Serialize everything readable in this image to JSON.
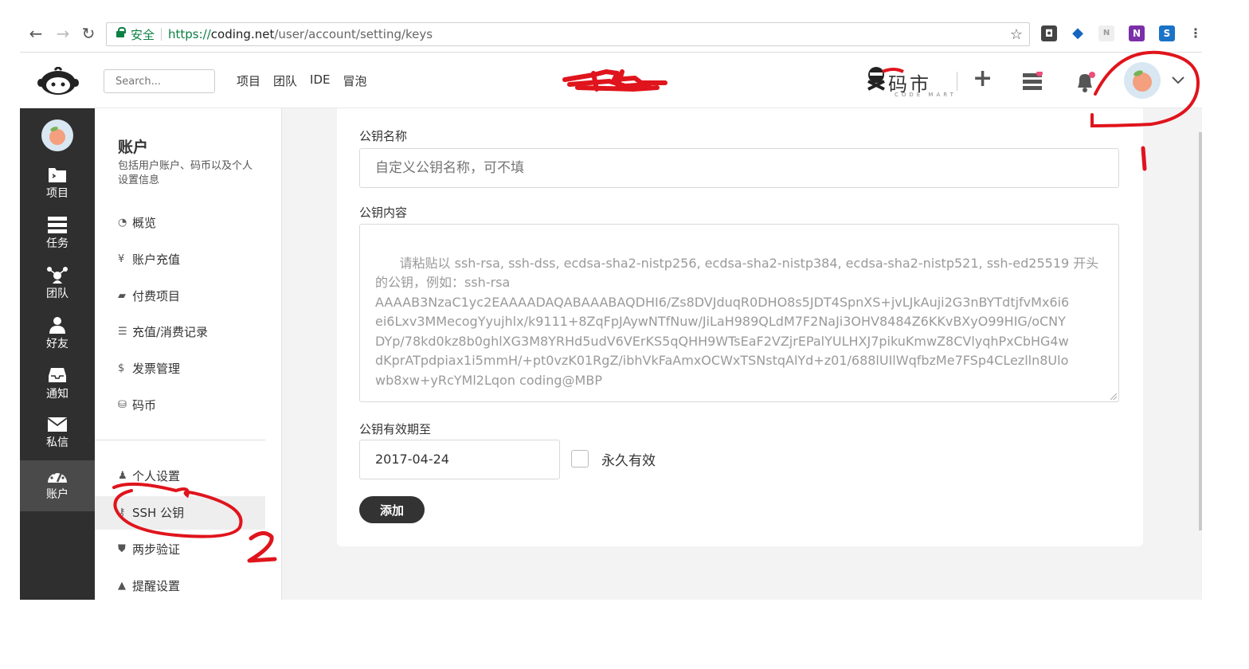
{
  "browser": {
    "secure_label": "安全",
    "url_scheme": "https://",
    "url_host": "coding.net",
    "url_path": "/user/account/setting/keys"
  },
  "header": {
    "search_placeholder": "Search...",
    "nav": [
      "项目",
      "团队",
      "IDE",
      "冒泡"
    ],
    "codemart_text": "码市",
    "codemart_sub": "CODE MART"
  },
  "dark_sidebar": {
    "items": [
      {
        "label": "项目",
        "icon": "project-folder-icon"
      },
      {
        "label": "任务",
        "icon": "tasks-icon"
      },
      {
        "label": "团队",
        "icon": "team-icon"
      },
      {
        "label": "好友",
        "icon": "friends-icon"
      },
      {
        "label": "通知",
        "icon": "notification-inbox-icon"
      },
      {
        "label": "私信",
        "icon": "message-envelope-icon"
      },
      {
        "label": "账户",
        "icon": "account-dashboard-icon"
      }
    ],
    "active": "账户"
  },
  "account_sidebar": {
    "title": "账户",
    "description": "包括用户账户、码币以及个人设置信息",
    "items": [
      {
        "label": "概览",
        "icon": "dashboard-icon"
      },
      {
        "label": "账户充值",
        "icon": "yen-icon"
      },
      {
        "label": "付费项目",
        "icon": "folder-icon"
      },
      {
        "label": "充值/消费记录",
        "icon": "list-icon"
      },
      {
        "label": "发票管理",
        "icon": "dollar-icon"
      },
      {
        "label": "码币",
        "icon": "coins-icon"
      },
      {
        "label": "个人设置",
        "icon": "user-icon"
      },
      {
        "label": "SSH 公钥",
        "icon": "key-icon"
      },
      {
        "label": "两步验证",
        "icon": "shield-icon"
      },
      {
        "label": "提醒设置",
        "icon": "bell-icon"
      }
    ],
    "active": "SSH 公钥"
  },
  "form": {
    "name_label": "公钥名称",
    "name_placeholder": "自定义公钥名称，可不填",
    "content_label": "公钥内容",
    "content_placeholder": "请粘贴以 ssh-rsa, ssh-dss, ecdsa-sha2-nistp256, ecdsa-sha2-nistp384, ecdsa-sha2-nistp521, ssh-ed25519 开头\n的公钥，例如：ssh-rsa\nAAAAB3NzaC1yc2EAAAADAQABAAABAQDHI6/Zs8DVJduqR0DHO8s5JDT4SpnXS+jvLJkAuji2G3nBYTdtjfvMx6i6\nei6Lxv3MMecogYyujhlx/k9111+8ZqFpJAywNTfNuw/JiLaH989QLdM7F2NaJi3OHV8484Z6KKvBXyO99HIG/oCNY\nDYp/78kd0kz8b0ghlXG3M8YRHd5udV6VErKS5qQHH9WTsEaF2VZjrEPalYULHXJ7pikuKmwZ8CVlyqhPxCbHG4w\ndKprATpdpiax1i5mmH/+pt0vzK01RgZ/ibhVkFaAmxOCWxTSNstqAlYd+z01/688lUIlWqfbzMe7FSp4CLezlln8Ulo\nwb8xw+yRcYMl2Lqon coding@MBP",
    "expiry_label": "公钥有效期至",
    "expiry_value": "2017-04-24",
    "permanent_label": "永久有效",
    "submit_label": "添加"
  },
  "annotations": {
    "mark_1": "1",
    "mark_2": "2"
  },
  "colors": {
    "dark_sidebar": "#2f2f2f",
    "secure_green": "#0b8043",
    "annotation_red": "#e0141c",
    "button_dark": "#333333"
  }
}
